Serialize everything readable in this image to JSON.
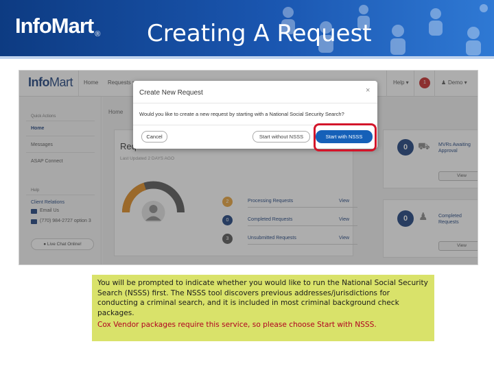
{
  "slide": {
    "logo": "InfoMart",
    "logo_mark": "®",
    "title": "Creating A Request"
  },
  "app": {
    "logo_info": "Info",
    "logo_mart": "Mart",
    "nav": {
      "home": "Home",
      "requests": "Requests ▾",
      "help": "Help ▾",
      "alerts_count": "1",
      "user": "Demo ▾"
    },
    "sidebar": {
      "quick_actions_heading": "Quick Actions",
      "items": [
        "Home",
        "Messages",
        "ASAP Connect"
      ],
      "help_heading": "Help",
      "client_relations": "Client Relations",
      "email": "Email Us",
      "phone": "(770) 984-2727 option 3",
      "live_chat": "Live Chat Online!"
    },
    "breadcrumb": "Home",
    "requests_card": {
      "title": "Req",
      "subtitle": "Last Updated 2 DAYS AGO",
      "rows": [
        {
          "count": "2",
          "label": "Processing Requests",
          "view": "View",
          "color": "#e8a33a"
        },
        {
          "count": "0",
          "label": "Completed Requests",
          "view": "View",
          "color": "#1a3f7c"
        },
        {
          "count": "3",
          "label": "Unsubmitted Requests",
          "view": "View",
          "color": "#555555"
        }
      ],
      "gauge_fraction": 0.4
    },
    "side_cards": [
      {
        "count": "0",
        "label_line1": "MVRs Awaiting",
        "label_line2": "Approval",
        "view": "View"
      },
      {
        "count": "0",
        "label_line1": "Completed",
        "label_line2": "Requests",
        "view": "View"
      }
    ],
    "modal": {
      "title": "Create New Request",
      "close": "×",
      "question": "Would you like to create a new request by starting with a National Social Security Search?",
      "cancel": "Cancel",
      "start_without": "Start without NSSS",
      "start_with": "Start with NSSS"
    }
  },
  "caption": {
    "paragraph": "You will be prompted to indicate whether you would like to run the National Social Security Search (NSSS) first. The NSSS tool discovers previous addresses/jurisdictions for conducting a criminal search, and it is included in most criminal background check packages.",
    "note": "Cox Vendor packages require this service, so please choose Start with NSSS."
  },
  "colors": {
    "header_blue": "#1a56b0",
    "caption_bg": "#d9e26a",
    "highlight_red": "#d3152a",
    "primary_button": "#1560b8"
  }
}
